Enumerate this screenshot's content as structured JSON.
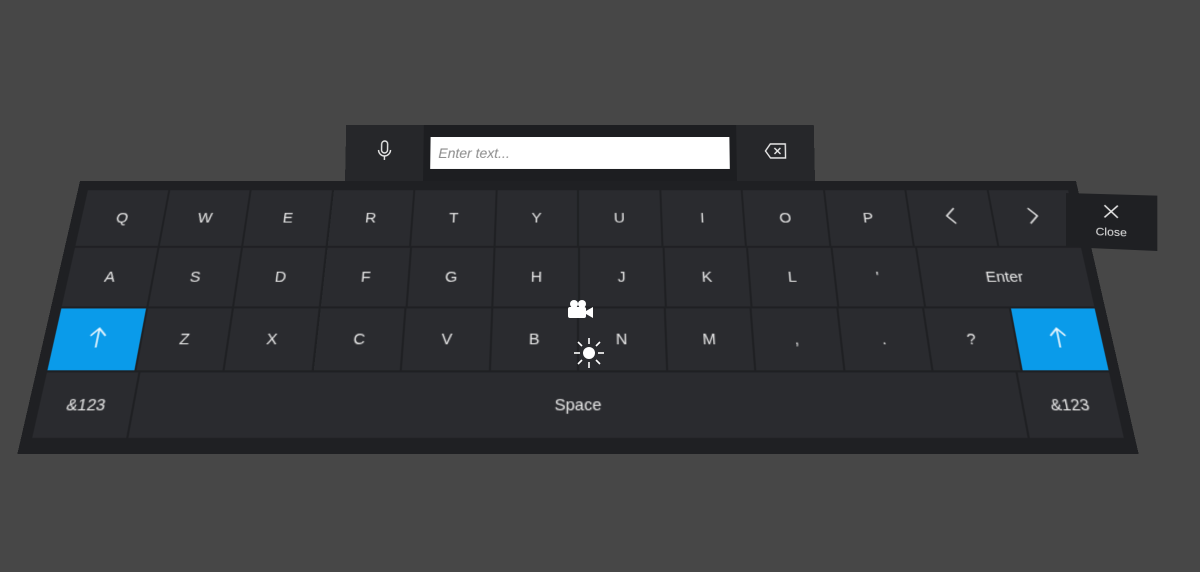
{
  "input": {
    "placeholder": "Enter text..."
  },
  "icons": {
    "mic": "microphone-icon",
    "backspace": "backspace-icon",
    "close": "close-icon",
    "camera": "video-camera-icon",
    "light": "sun-icon",
    "left": "chevron-left-icon",
    "right": "chevron-right-icon",
    "shift": "shift-arrow-icon"
  },
  "colors": {
    "accent": "#0a9bea",
    "panel": "#1f2023",
    "key": "#2a2b2f"
  },
  "close": {
    "label": "Close"
  },
  "rows": {
    "r1": [
      "Q",
      "W",
      "E",
      "R",
      "T",
      "Y",
      "U",
      "I",
      "O",
      "P"
    ],
    "r2": [
      "A",
      "S",
      "D",
      "F",
      "G",
      "H",
      "J",
      "K",
      "L",
      "'"
    ],
    "r3": [
      "Z",
      "X",
      "C",
      "V",
      "B",
      "N",
      "M",
      ",",
      ".",
      "?"
    ]
  },
  "keys": {
    "enter": "Enter",
    "space": "Space",
    "sym_left": "&123",
    "sym_right": "&123"
  }
}
